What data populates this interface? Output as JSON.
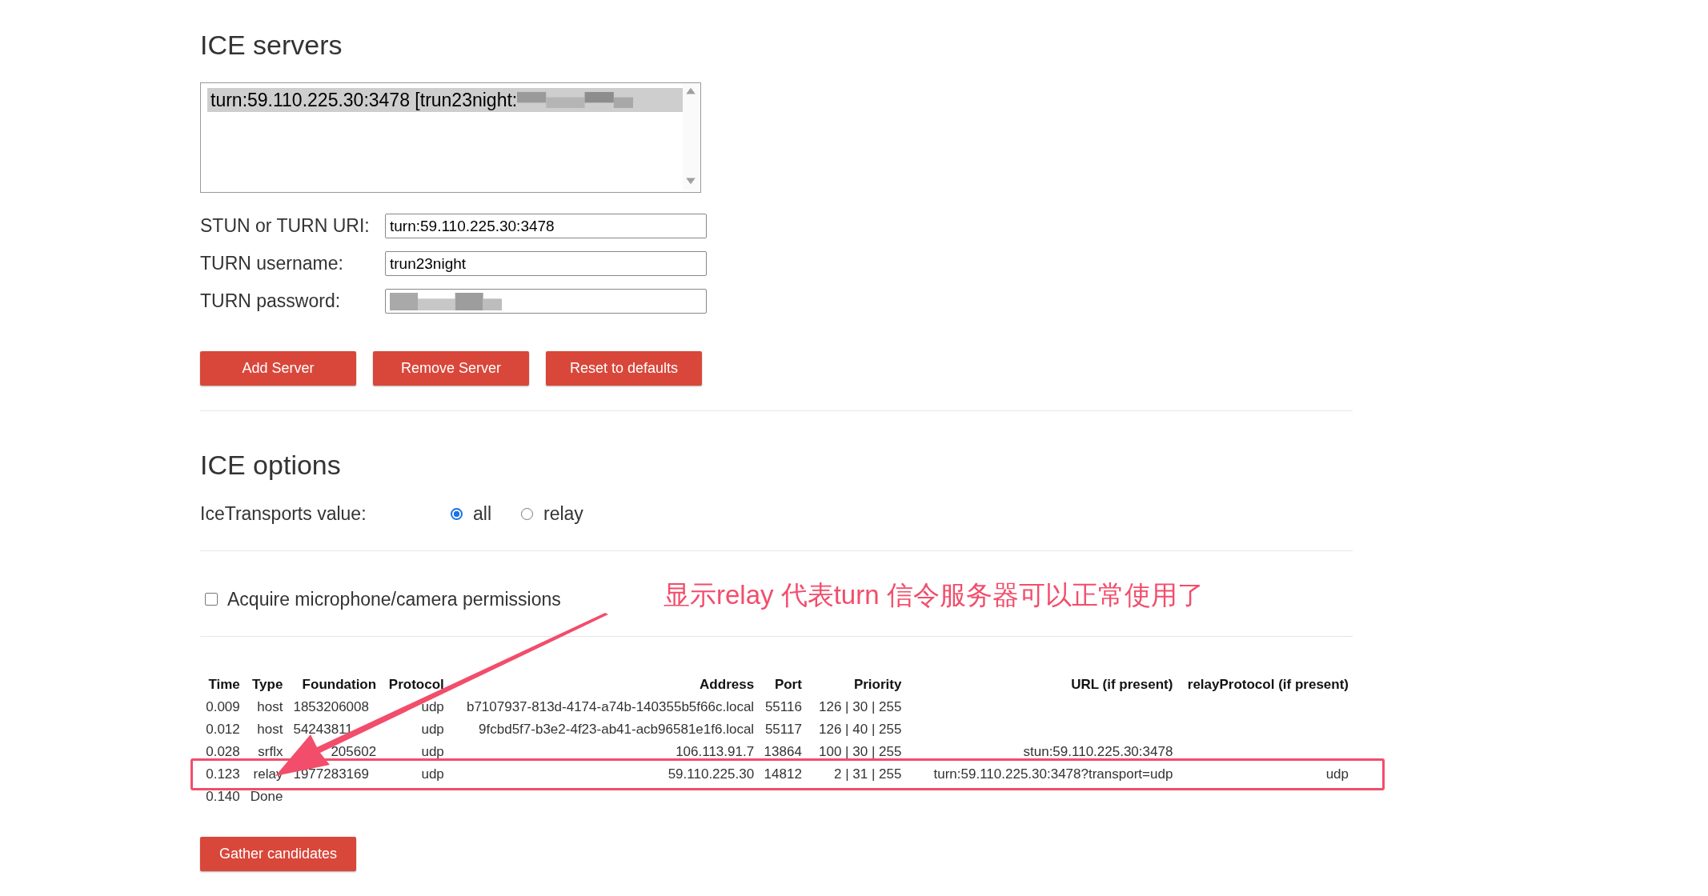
{
  "ice_servers": {
    "title": "ICE servers",
    "list": [
      {
        "text": "turn:59.110.225.30:3478 [trun23night:",
        "redacted": true,
        "selected": true
      }
    ],
    "fields": [
      {
        "label": "STUN or TURN URI:",
        "value": "turn:59.110.225.30:3478",
        "redacted": false
      },
      {
        "label": "TURN username:",
        "value": "trun23night",
        "redacted": false
      },
      {
        "label": "TURN password:",
        "redacted": true
      }
    ],
    "buttons": [
      "Add Server",
      "Remove Server",
      "Reset to defaults"
    ]
  },
  "ice_options": {
    "title": "ICE options",
    "transports_label": "IceTransports value:",
    "radios": [
      {
        "label": "all",
        "selected": true
      },
      {
        "label": "relay",
        "selected": false
      }
    ],
    "permission": {
      "label": "Acquire microphone/camera permissions",
      "checked": false
    }
  },
  "annotation": {
    "text": "显示relay 代表turn 信令服务器可以正常使用了"
  },
  "table": {
    "columns": [
      "Time",
      "Type",
      "Foundation",
      "Protocol",
      "Address",
      "Port",
      "Priority",
      "URL (if present)",
      "relayProtocol (if present)"
    ],
    "rows": [
      {
        "cells": [
          "0.009",
          "host",
          "1853206008",
          "udp",
          "b7107937-813d-4174-a74b-140355b5f66c.local",
          "55116",
          "126 | 30 | 255",
          "",
          ""
        ],
        "foundation_cut": false,
        "highlighted": false
      },
      {
        "cells": [
          "0.012",
          "host",
          "54243811",
          "udp",
          "9fcbd5f7-b3e2-4f23-ab41-acb96581e1f6.local",
          "55117",
          "126 | 40 | 255",
          "",
          ""
        ],
        "foundation_cut": false,
        "highlighted": false
      },
      {
        "cells": [
          "0.028",
          "srflx",
          "205602",
          "udp",
          "106.113.91.7",
          "13864",
          "100 | 30 | 255",
          "stun:59.110.225.30:3478",
          ""
        ],
        "foundation_cut": true,
        "highlighted": false
      },
      {
        "cells": [
          "0.123",
          "relay",
          "1977283169",
          "udp",
          "59.110.225.30",
          "14812",
          "2 | 31 | 255",
          "turn:59.110.225.30:3478?transport=udp",
          "udp"
        ],
        "foundation_cut": false,
        "highlighted": true
      },
      {
        "cells": [
          "0.140",
          "Done"
        ],
        "highlighted": false
      }
    ]
  },
  "gather_button": "Gather candidates"
}
